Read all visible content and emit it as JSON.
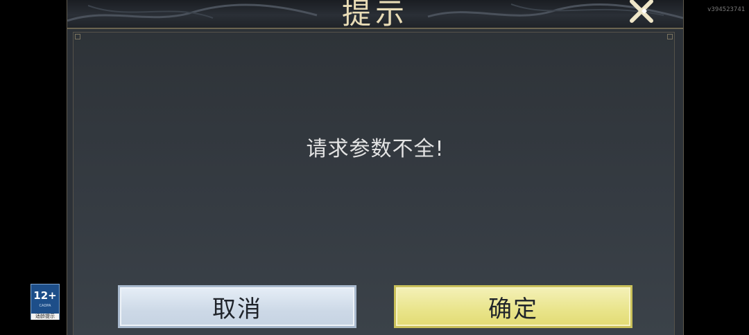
{
  "dialog": {
    "title": "提示",
    "message": "请求参数不全!",
    "buttons": {
      "cancel_label": "取消",
      "confirm_label": "确定"
    },
    "close_icon": "close-icon"
  },
  "age_badge": {
    "rating": "12+",
    "org": "CADPA",
    "label": "适龄提示"
  },
  "version_text": "v394523741",
  "colors": {
    "dialog_bg": "#2c3137",
    "title_text": "#e9dcb6",
    "cancel_button": "#cdd9e7",
    "confirm_button": "#e9e48a"
  }
}
